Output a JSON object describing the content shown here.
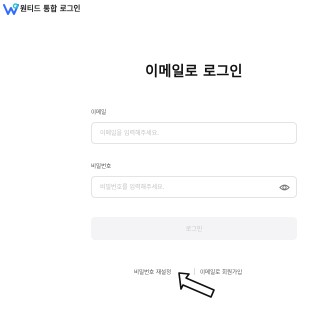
{
  "header": {
    "title": "원티드 통합 로그인"
  },
  "main": {
    "title": "이메일로 로그인"
  },
  "email": {
    "label": "이메일",
    "placeholder": "이메일을 입력해주세요.",
    "value": ""
  },
  "password": {
    "label": "비밀번호",
    "placeholder": "비밀번호를 입력해주세요.",
    "value": "",
    "toggle_icon": "eye-icon"
  },
  "login_button": {
    "label": "로그인",
    "state": "disabled"
  },
  "links": {
    "reset_password": "비밀번호 재설정",
    "signup": "이메일로 회원가입"
  },
  "colors": {
    "brand_blue": "#2f6bff",
    "brand_cyan": "#22c3d6",
    "disabled_bg": "#f4f4f6",
    "disabled_text": "#c7c7cc"
  }
}
